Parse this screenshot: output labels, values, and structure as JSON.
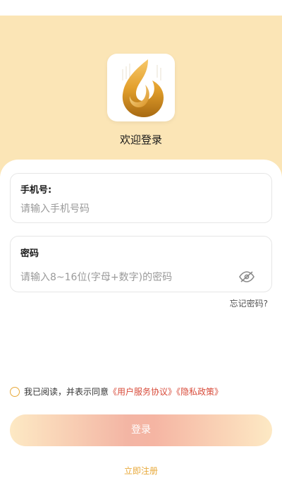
{
  "header": {
    "welcome_text": "欢迎登录"
  },
  "login_form": {
    "phone": {
      "label": "手机号:",
      "placeholder": "请输入手机号码"
    },
    "password": {
      "label": "密码",
      "placeholder": "请输入8~16位(字母+数字)的密码"
    },
    "forgot_password": "忘记密码?"
  },
  "agreement": {
    "prefix": "我已阅读，并表示同意",
    "user_agreement": "《用户服务协议》",
    "privacy_policy": "《隐私政策》"
  },
  "actions": {
    "login_label": "登录",
    "register_label": "立即注册"
  },
  "icons": {
    "logo": "flame-logo-icon",
    "password_visibility": "eye-off-icon",
    "agree_checkbox": "radio-circle-icon"
  },
  "colors": {
    "header_bg": "#fbe5b6",
    "accent": "#e8a93a",
    "link": "#d84b3a"
  }
}
